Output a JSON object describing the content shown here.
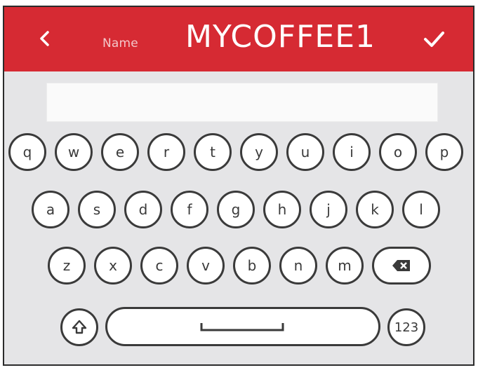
{
  "header": {
    "back_icon": "chevron-left-icon",
    "name_label": "Name",
    "title": "MYCOFFEE1",
    "confirm_icon": "checkmark-icon",
    "bg_color": "#d62a33"
  },
  "input": {
    "value": ""
  },
  "keyboard": {
    "row1": [
      "q",
      "w",
      "e",
      "r",
      "t",
      "y",
      "u",
      "i",
      "o",
      "p"
    ],
    "row2": [
      "a",
      "s",
      "d",
      "f",
      "g",
      "h",
      "j",
      "k",
      "l"
    ],
    "row3": [
      "z",
      "x",
      "c",
      "v",
      "b",
      "n",
      "m"
    ],
    "backspace_icon": "backspace-icon",
    "shift_icon": "shift-icon",
    "space_icon": "space-icon",
    "numbers_label": "123"
  }
}
